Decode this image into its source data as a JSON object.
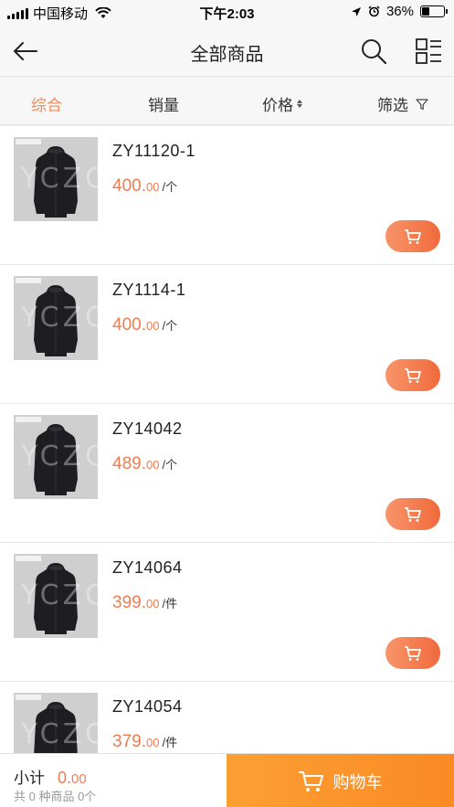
{
  "status_bar": {
    "carrier": "中国移动",
    "time": "下午2:03",
    "battery_pct": "36%",
    "battery_level": 0.36
  },
  "header": {
    "title": "全部商品"
  },
  "filters": [
    {
      "label": "综合",
      "active": true
    },
    {
      "label": "销量",
      "active": false
    },
    {
      "label": "价格",
      "active": false
    },
    {
      "label": "筛选",
      "active": false
    }
  ],
  "products": [
    {
      "code": "ZY11120-1",
      "price_int": "400.",
      "price_dec": "00",
      "unit": "/个"
    },
    {
      "code": "ZY1114-1",
      "price_int": "400.",
      "price_dec": "00",
      "unit": "/个"
    },
    {
      "code": "ZY14042",
      "price_int": "489.",
      "price_dec": "00",
      "unit": "/个"
    },
    {
      "code": "ZY14064",
      "price_int": "399.",
      "price_dec": "00",
      "unit": "/件"
    },
    {
      "code": "ZY14054",
      "price_int": "379.",
      "price_dec": "00",
      "unit": "/件"
    }
  ],
  "watermark": "YCZC",
  "footer": {
    "subtotal_label": "小计",
    "subtotal_int": "0.",
    "subtotal_dec": "00",
    "summary": "共 0 种商品 0个",
    "cart_label": "购物车"
  },
  "colors": {
    "accent": "#ef7c50",
    "cart_orange": "#fa8a24"
  }
}
